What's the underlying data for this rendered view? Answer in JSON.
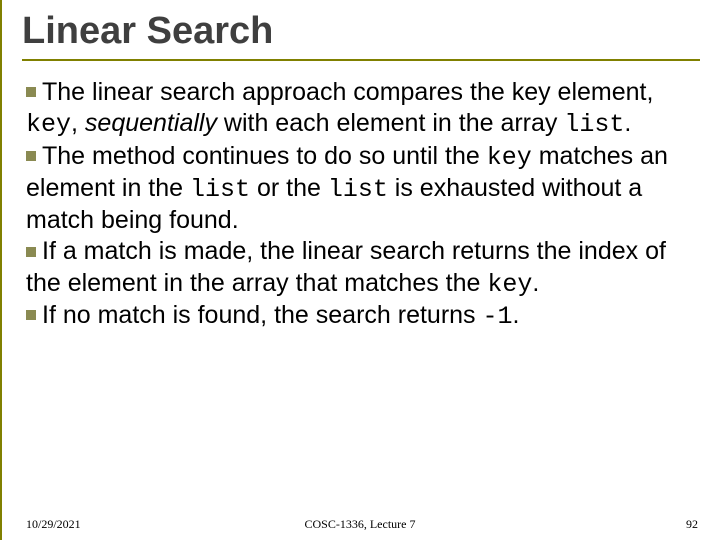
{
  "title": "Linear Search",
  "bullets": [
    {
      "pre": "The linear search approach compares the key element, ",
      "code1": "key",
      "mid1": ", ",
      "ital": "sequentially",
      "mid2": " with each element in the array ",
      "code2": "list",
      "post": "."
    },
    {
      "pre": "The method continues to do so until the ",
      "code1": "key",
      "mid1": " matches an element in the ",
      "code2": "list",
      "mid2": " or the ",
      "code3": "list",
      "post": " is exhausted without a match being found."
    },
    {
      "pre": "If a match is made, the linear search returns the index of the element in the array that matches the ",
      "code1": "key",
      "post": "."
    },
    {
      "pre": "If no match is found, the search returns ",
      "code1": "-1",
      "post": "."
    }
  ],
  "footer": {
    "date": "10/29/2021",
    "center": "COSC-1336, Lecture 7",
    "page": "92"
  }
}
